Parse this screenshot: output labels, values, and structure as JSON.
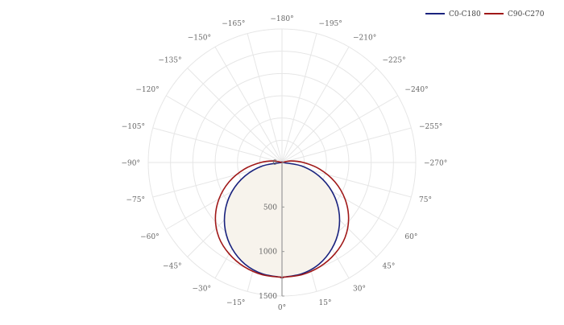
{
  "chart_data": {
    "type": "polar-line",
    "title": "",
    "angle_labels": [
      "0°",
      "15°",
      "30°",
      "45°",
      "60°",
      "75°",
      "−270°",
      "−255°",
      "−240°",
      "−225°",
      "−210°",
      "−195°",
      "−180°",
      "−165°",
      "−150°",
      "−135°",
      "−120°",
      "−105°",
      "−90°",
      "−75°",
      "−60°",
      "−45°",
      "−30°",
      "−15°"
    ],
    "radial_labels": [
      "0",
      "500",
      "1000",
      "1500"
    ],
    "rlim": [
      0,
      1500
    ],
    "grid": true,
    "legend_position": "top-right",
    "series": [
      {
        "name": "C0-C180",
        "color": "#1a237e",
        "angles_deg": [
          0,
          10,
          20,
          30,
          40,
          50,
          60,
          70,
          80,
          90
        ],
        "values": [
          1290,
          1270,
          1215,
          1118,
          990,
          830,
          645,
          440,
          222,
          0
        ]
      },
      {
        "name": "C90-C270",
        "color": "#a01818",
        "angles_deg": [
          0,
          10,
          20,
          30,
          40,
          50,
          60,
          70,
          80,
          90,
          100,
          110
        ],
        "values": [
          1290,
          1280,
          1245,
          1185,
          1100,
          975,
          815,
          630,
          430,
          240,
          100,
          0
        ]
      }
    ],
    "fill_color": "#f7f3ec"
  }
}
